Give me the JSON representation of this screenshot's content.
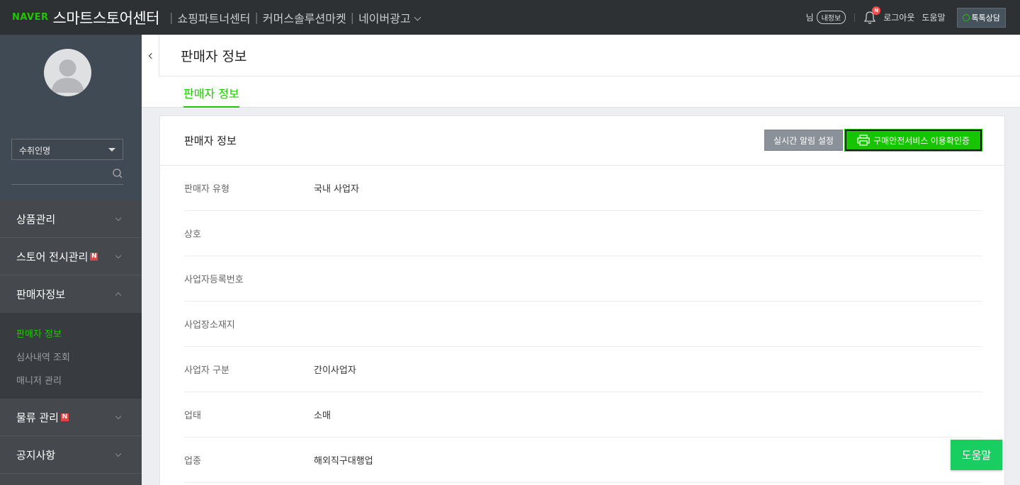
{
  "topbar": {
    "brand_naver": "NAVER",
    "brand_title": "스마트스토어센터",
    "nav": [
      {
        "label": "쇼핑파트너센터"
      },
      {
        "label": "커머스솔루션마켓"
      },
      {
        "label": "네이버광고"
      }
    ],
    "user_suffix": "님",
    "my_info_label": "내정보",
    "bell_badge": "N",
    "logout_label": "로그아웃",
    "help_label": "도움말",
    "talk_label": "톡톡상담"
  },
  "sidebar": {
    "store_select_value": "수취인명",
    "menu_top": [
      {
        "label": "상품관리",
        "new": false
      },
      {
        "label": "스토어 전시관리",
        "new": true
      },
      {
        "label": "판매자정보",
        "new": false,
        "expanded": true
      }
    ],
    "submenu": [
      {
        "label": "판매자 정보",
        "active": true
      },
      {
        "label": "심사내역 조회",
        "active": false
      },
      {
        "label": "매니저 관리",
        "active": false
      }
    ],
    "menu_bottom": [
      {
        "label": "물류 관리",
        "new": true
      },
      {
        "label": "공지사항",
        "new": false
      }
    ],
    "new_badge": "N"
  },
  "page": {
    "title": "판매자 정보",
    "tab": "판매자 정보"
  },
  "panel": {
    "title": "판매자 정보",
    "btn_alarm": "실시간 알림 설정",
    "btn_safe": "구매안전서비스 이용확인증",
    "rows": [
      {
        "label": "판매자 유형",
        "value": "국내 사업자"
      },
      {
        "label": "상호",
        "value": ""
      },
      {
        "label": "사업자등록번호",
        "value": ""
      },
      {
        "label": "사업장소재지",
        "value": ""
      },
      {
        "label": "사업자 구분",
        "value": "간이사업자"
      },
      {
        "label": "업태",
        "value": "소매"
      },
      {
        "label": "업종",
        "value": "해외직구대행업"
      }
    ]
  },
  "help_float": "도움말",
  "colors": {
    "accent_green": "#1ec800",
    "topbar_bg": "#2e3133",
    "sidebar_bg": "#45484c"
  }
}
